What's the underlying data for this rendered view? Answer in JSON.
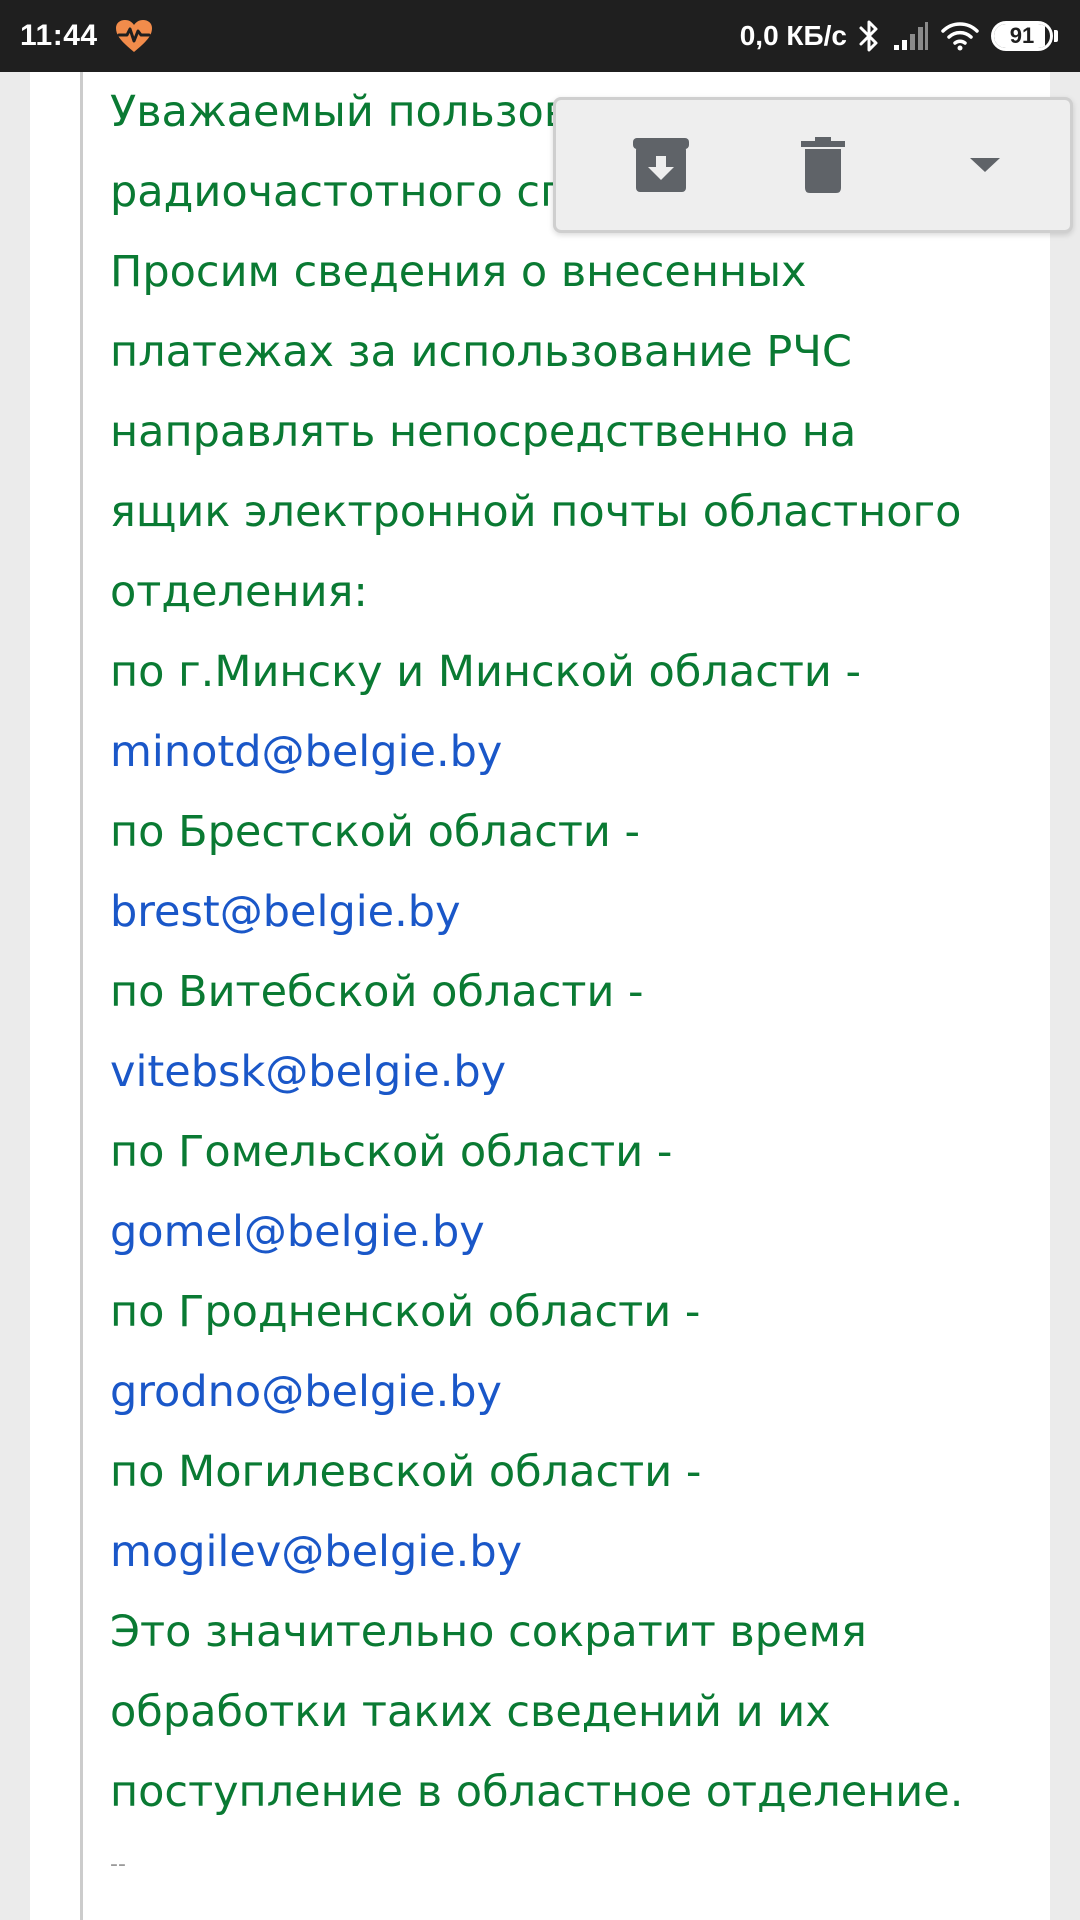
{
  "status_bar": {
    "time": "11:44",
    "net_speed": "0,0 КБ/с",
    "battery_level": "91",
    "battery_fraction": 0.91,
    "icons": [
      "heart-rate-icon",
      "bluetooth-icon",
      "signal-icon",
      "wifi-icon",
      "battery-icon"
    ]
  },
  "toolbar": {
    "archive_icon": "archive-icon",
    "delete_icon": "trash-icon",
    "more_icon": "dropdown-arrow-icon"
  },
  "email": {
    "lines": [
      {
        "text": "Уважаемый пользователь",
        "type": "text"
      },
      {
        "text": "радиочастотного спектра!",
        "type": "text"
      },
      {
        "text": "Просим сведения о внесенных",
        "type": "text"
      },
      {
        "text": "платежах за использование РЧС",
        "type": "text"
      },
      {
        "text": "направлять непосредственно на",
        "type": "text"
      },
      {
        "text": "ящик электронной почты областного",
        "type": "text"
      },
      {
        "text": "отделения:",
        "type": "text"
      },
      {
        "text": "по г.Минску и Минской области -",
        "type": "text"
      },
      {
        "text": "minotd@belgie.by",
        "type": "link"
      },
      {
        "text": "по Брестской области -",
        "type": "text"
      },
      {
        "text": "brest@belgie.by",
        "type": "link"
      },
      {
        "text": "по Витебской области -",
        "type": "text"
      },
      {
        "text": "vitebsk@belgie.by",
        "type": "link"
      },
      {
        "text": "по Гомельской области -",
        "type": "text"
      },
      {
        "text": "gomel@belgie.by",
        "type": "link"
      },
      {
        "text": "по Гродненской области -",
        "type": "text"
      },
      {
        "text": "grodno@belgie.by",
        "type": "link"
      },
      {
        "text": "по Могилевской области -",
        "type": "text"
      },
      {
        "text": "mogilev@belgie.by",
        "type": "link"
      },
      {
        "text": "Это значительно сократит время",
        "type": "text"
      },
      {
        "text": "обработки таких сведений и их",
        "type": "text"
      },
      {
        "text": "поступление в областное отделение.",
        "type": "text"
      }
    ],
    "signature_separator": "--"
  },
  "colors": {
    "body_text": "#0a7a33",
    "link": "#1a57c8",
    "status_bar_bg": "#1f1f1f",
    "heart_icon": "#f28c4b"
  }
}
